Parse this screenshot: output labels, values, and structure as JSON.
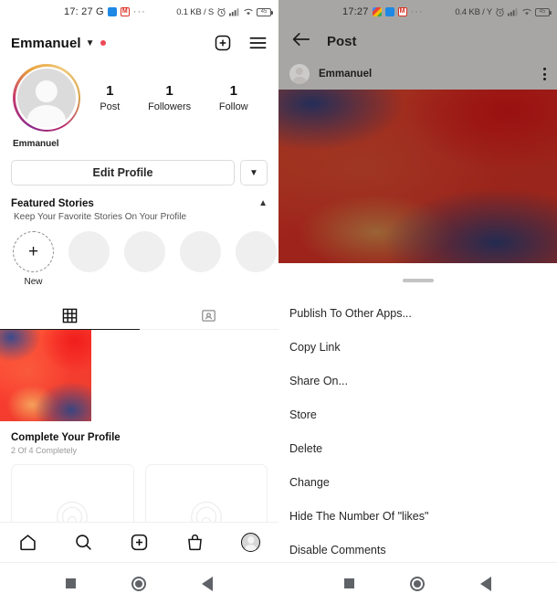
{
  "left": {
    "statusbar": {
      "time": "17: 27 G",
      "app_icons": [
        "telegram-icon",
        "gmail-icon"
      ],
      "overflow": "···",
      "network_speed": "0.1 KB / S",
      "alarm_icon": "alarm-icon",
      "signal_icon": "signal-icon",
      "wifi_icon": "wifi-icon",
      "battery_level": "45"
    },
    "header": {
      "username": "Emmanuel",
      "caret_icon": "chevron-down-icon",
      "badge_dot": "notification-dot",
      "add_icon": "plus-square-icon",
      "menu_icon": "hamburger-menu-icon"
    },
    "profile": {
      "display_name": "Emmanuel",
      "stats": [
        {
          "num": "1",
          "label": "Post"
        },
        {
          "num": "1",
          "label": "Followers"
        },
        {
          "num": "1",
          "label": "Follow"
        }
      ],
      "edit_button": "Edit Profile",
      "edit_caret_icon": "chevron-down-icon"
    },
    "featured": {
      "title": "Featured Stories",
      "subtitle": "Keep Your Favorite Stories On Your Profile",
      "collapse_icon": "chevron-up-icon",
      "new_label": "New",
      "new_icon": "plus-icon",
      "placeholder_count": 4
    },
    "tabs": [
      {
        "icon": "grid-icon",
        "active": true
      },
      {
        "icon": "tagged-person-icon",
        "active": false
      }
    ],
    "grid": {
      "post_count": 1,
      "empty_cells": 2
    },
    "complete_profile": {
      "title": "Complete Your Profile",
      "subtitle": "2 Of 4 Completely",
      "cards": [
        "add-photo-card",
        "add-bio-card"
      ]
    },
    "bottom_nav": [
      {
        "icon": "home-icon",
        "active": true
      },
      {
        "icon": "search-icon",
        "active": false
      },
      {
        "icon": "add-post-icon",
        "active": false
      },
      {
        "icon": "shop-bag-icon",
        "active": false
      },
      {
        "icon": "profile-avatar-icon",
        "active": true
      }
    ]
  },
  "right": {
    "statusbar": {
      "time": "17:27",
      "app_icons": [
        "google-icon",
        "telegram-icon",
        "gmail-icon"
      ],
      "overflow": "···",
      "network_speed": "0.4 KB / Y",
      "alarm_icon": "alarm-icon",
      "signal_icon": "signal-icon",
      "wifi_icon": "wifi-icon",
      "battery_level": "45"
    },
    "header": {
      "back_icon": "back-arrow-icon",
      "title": "Post"
    },
    "post": {
      "username": "Emmanuel",
      "more_icon": "more-vertical-icon",
      "avatar": "user-avatar"
    },
    "sheet": {
      "handle": "drag-handle",
      "items": [
        "Publish To Other Apps...",
        "Copy Link",
        "Share On...",
        "Store",
        "Delete",
        "Change",
        "Hide The Number Of \"likes\"",
        "Disable Comments"
      ]
    }
  },
  "system_nav": {
    "recents_icon": "square-recents-icon",
    "home_icon": "circle-home-icon",
    "back_icon": "triangle-back-icon"
  },
  "colors": {
    "accent_red": "#ed4956",
    "story_ring_start": "#b5276a",
    "story_ring_end": "#e8a33d",
    "text_primary": "#111111",
    "text_secondary": "#8e8e8e",
    "dim_overlay": "#a8a6a4"
  }
}
